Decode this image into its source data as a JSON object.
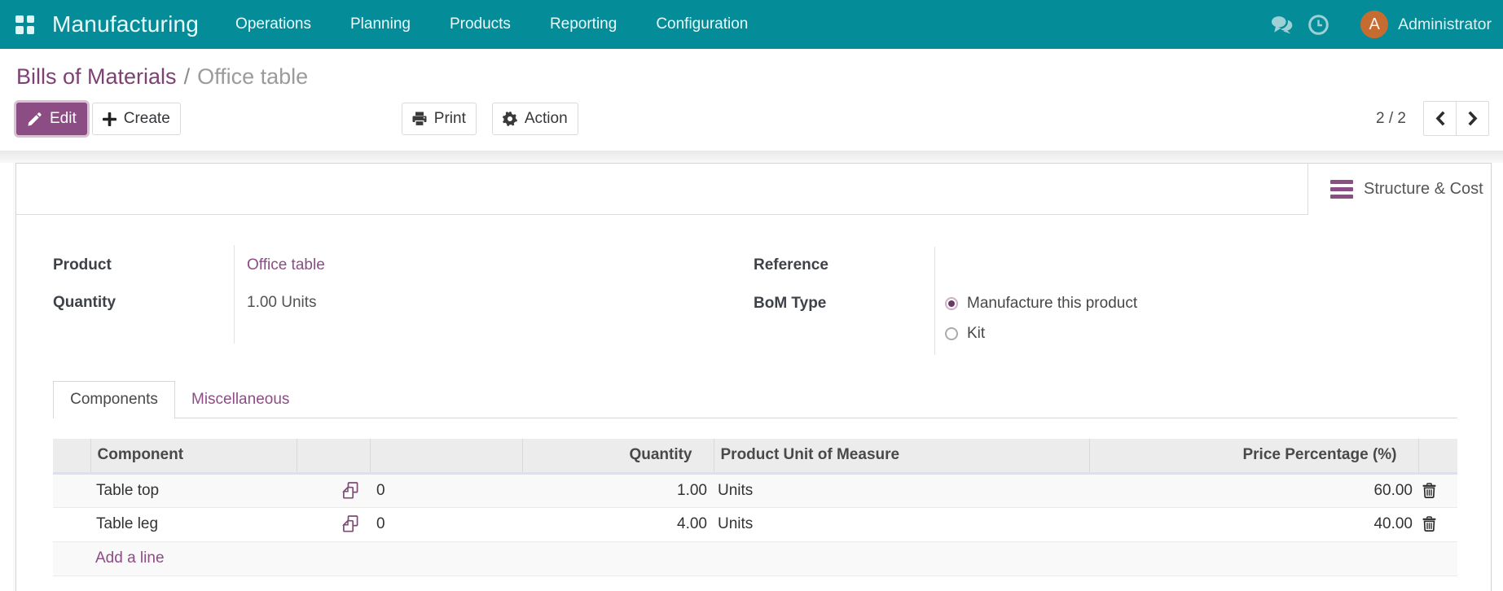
{
  "navbar": {
    "app_name": "Manufacturing",
    "menus": [
      "Operations",
      "Planning",
      "Products",
      "Reporting",
      "Configuration"
    ],
    "user_name": "Administrator",
    "avatar_initial": "A"
  },
  "breadcrumb": {
    "parent": "Bills of Materials",
    "separator": "/",
    "current": "Office table"
  },
  "toolbar": {
    "edit_label": "Edit",
    "create_label": "Create",
    "print_label": "Print",
    "action_label": "Action",
    "pager_value": "2 / 2"
  },
  "sheet": {
    "stat_button_label": "Structure & Cost"
  },
  "fields": {
    "product_label": "Product",
    "product_value": "Office table",
    "quantity_label": "Quantity",
    "quantity_value": "1.00 Units",
    "reference_label": "Reference",
    "reference_value": "",
    "bom_type_label": "BoM Type",
    "bom_type_options": [
      {
        "label": "Manufacture this product",
        "selected": true
      },
      {
        "label": "Kit",
        "selected": false
      }
    ]
  },
  "tabs": [
    {
      "label": "Components",
      "active": true
    },
    {
      "label": "Miscellaneous",
      "active": false
    }
  ],
  "components_table": {
    "headers": {
      "component": "Component",
      "quantity": "Quantity",
      "uom": "Product Unit of Measure",
      "price": "Price Percentage (%)"
    },
    "rows": [
      {
        "component": "Table top",
        "operations_count": "0",
        "quantity": "1.00",
        "uom": "Units",
        "price": "60.00"
      },
      {
        "component": "Table leg",
        "operations_count": "0",
        "quantity": "4.00",
        "uom": "Units",
        "price": "40.00"
      }
    ],
    "add_line_label": "Add a line"
  },
  "colors": {
    "navbar_teal": "#058c99",
    "accent_purple": "#8b4d84",
    "avatar_orange": "#c76c31"
  }
}
